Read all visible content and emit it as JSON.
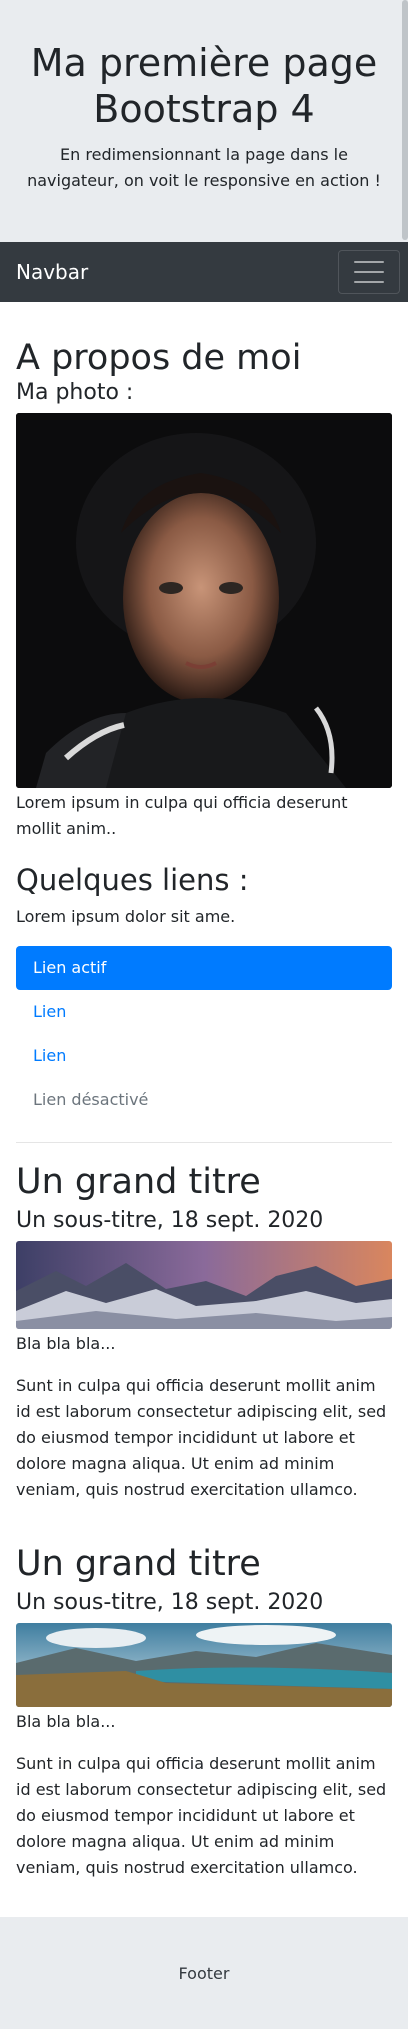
{
  "jumbotron": {
    "title": "Ma première page Bootstrap 4",
    "lead": "En redimensionnant la page dans le navigateur, on voit le responsive en action !"
  },
  "navbar": {
    "brand": "Navbar",
    "toggler_icon": "hamburger-menu-icon"
  },
  "about": {
    "title": "A propos de moi",
    "photo_label": "Ma photo :",
    "photo_caption": "Lorem ipsum in culpa qui officia deserunt mollit anim.."
  },
  "links": {
    "title": "Quelques liens :",
    "intro": "Lorem ipsum dolor sit ame.",
    "items": [
      {
        "label": "Lien actif",
        "state": "active"
      },
      {
        "label": "Lien",
        "state": "normal"
      },
      {
        "label": "Lien",
        "state": "normal"
      },
      {
        "label": "Lien désactivé",
        "state": "disabled"
      }
    ]
  },
  "articles": [
    {
      "title": "Un grand titre",
      "subtitle": "Un sous-titre, 18 sept. 2020",
      "caption": "Bla bla bla...",
      "body": "Sunt in culpa qui officia deserunt mollit anim id est laborum consectetur adipiscing elit, sed do eiusmod tempor incididunt ut labore et dolore magna aliqua. Ut enim ad minim veniam, quis nostrud exercitation ullamco."
    },
    {
      "title": "Un grand titre",
      "subtitle": "Un sous-titre, 18 sept. 2020",
      "caption": "Bla bla bla...",
      "body": "Sunt in culpa qui officia deserunt mollit anim id est laborum consectetur adipiscing elit, sed do eiusmod tempor incididunt ut labore et dolore magna aliqua. Ut enim ad minim veniam, quis nostrud exercitation ullamco."
    }
  ],
  "footer": {
    "text": "Footer"
  },
  "colors": {
    "primary": "#007bff",
    "navbar_bg": "#343a40",
    "jumbotron_bg": "#e9ecef",
    "muted": "#6c757d"
  }
}
